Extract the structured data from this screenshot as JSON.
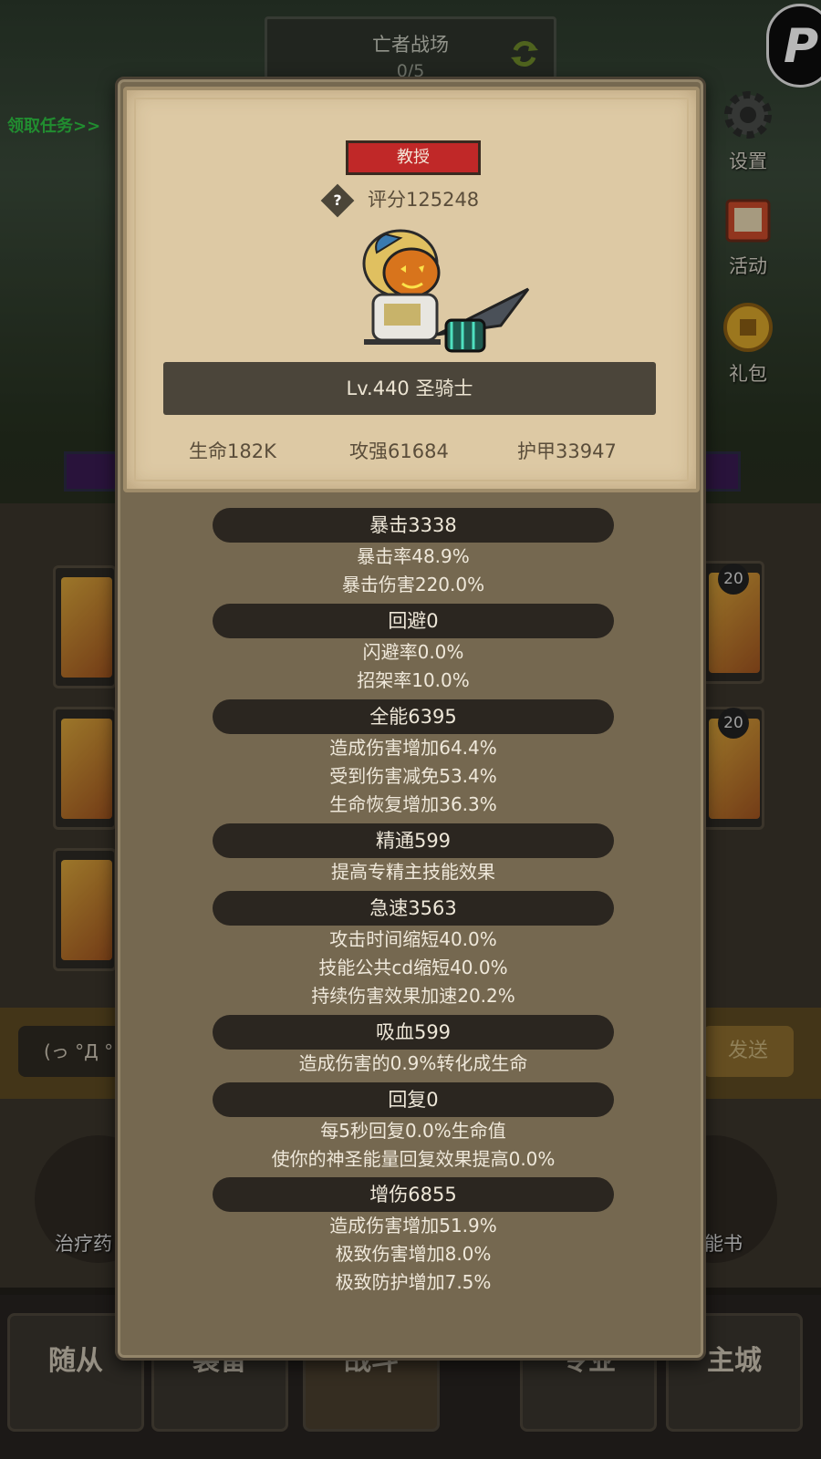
{
  "background": {
    "dungeon_title": "亡者战场",
    "dungeon_progress": "0/5",
    "quest_link": "领取任务>>",
    "side_buttons": [
      {
        "label": "设置",
        "icon": "gear-icon"
      },
      {
        "label": "活动",
        "icon": "scroll-icon"
      },
      {
        "label": "礼包",
        "icon": "gift-coin-icon"
      }
    ],
    "slot_counts": [
      "20",
      "20"
    ],
    "chat_placeholder": "(っ °Д °",
    "chat_send": "发送",
    "quick_left_label": "治疗药",
    "quick_right_label": "能书",
    "nav_tabs": [
      "随从",
      "装备",
      "战斗",
      "专业",
      "主城"
    ]
  },
  "modal": {
    "title_tag": "教授",
    "rating": "评分125248",
    "hero_name": "Lv.440 圣骑士",
    "core_stats": {
      "hp": "生命182K",
      "attack": "攻强61684",
      "armor": "护甲33947"
    },
    "stat_groups": [
      {
        "head": "暴击3338",
        "lines": [
          "暴击率48.9%",
          "暴击伤害220.0%"
        ]
      },
      {
        "head": "回避0",
        "lines": [
          "闪避率0.0%",
          "招架率10.0%"
        ]
      },
      {
        "head": "全能6395",
        "lines": [
          "造成伤害增加64.4%",
          "受到伤害减免53.4%",
          "生命恢复增加36.3%"
        ]
      },
      {
        "head": "精通599",
        "lines": [
          "提高专精主技能效果"
        ]
      },
      {
        "head": "急速3563",
        "lines": [
          "攻击时间缩短40.0%",
          "技能公共cd缩短40.0%",
          "持续伤害效果加速20.2%"
        ]
      },
      {
        "head": "吸血599",
        "lines": [
          "造成伤害的0.9%转化成生命"
        ]
      },
      {
        "head": "回复0",
        "lines": [
          "每5秒回复0.0%生命值",
          "使你的神圣能量回复效果提高0.0%"
        ]
      },
      {
        "head": "增伤6855",
        "lines": [
          "造成伤害增加51.9%",
          "极致伤害增加8.0%",
          "极致防护增加7.5%"
        ]
      }
    ]
  },
  "colors": {
    "title_tag_bg": "#c02828",
    "card_bg": "#ddc9a4",
    "modal_bg": "#756850",
    "stat_head_bg": "#2b2620",
    "quest_link": "#2fc443"
  }
}
